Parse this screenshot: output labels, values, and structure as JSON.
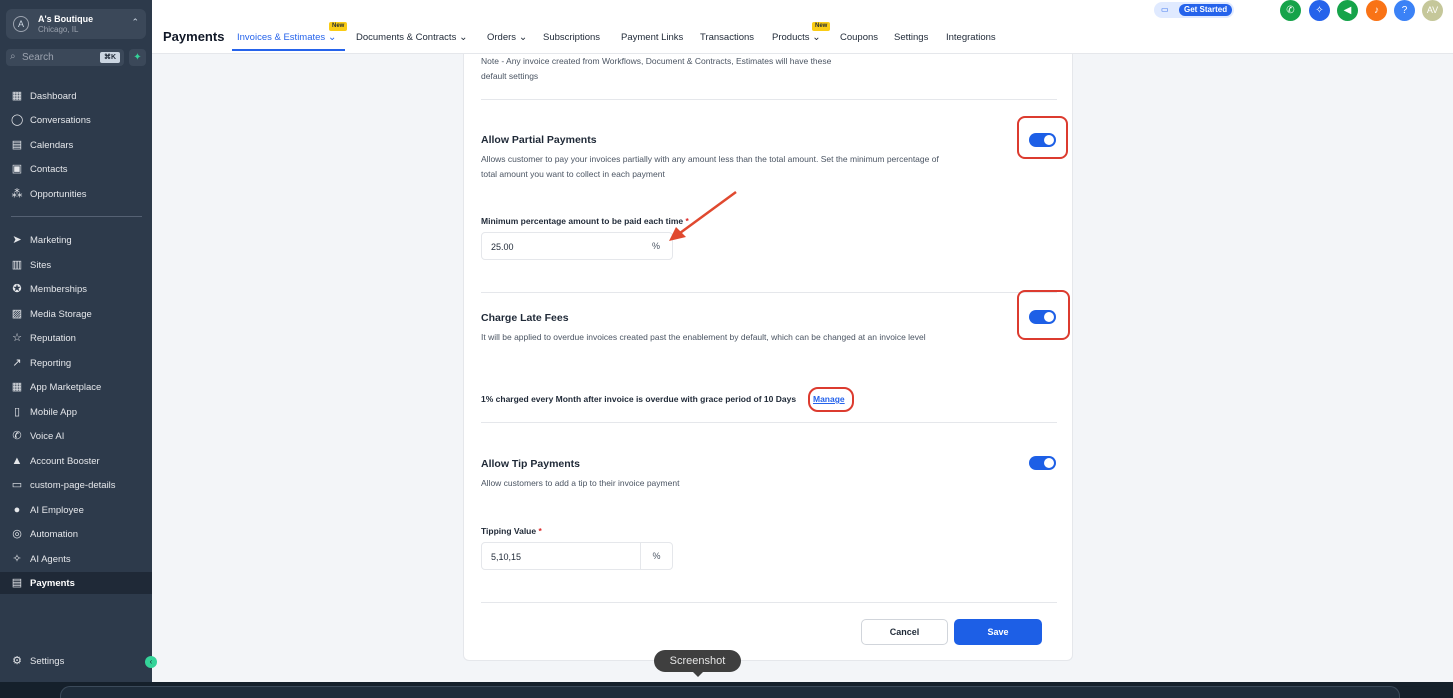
{
  "account": {
    "name": "A's Boutique",
    "location": "Chicago, IL",
    "avatar": "A"
  },
  "search": {
    "placeholder": "Search",
    "shortcut": "⌘K"
  },
  "sidebar": {
    "items": [
      {
        "label": "Dashboard",
        "icon": "grid-icon",
        "glyph": "▦"
      },
      {
        "label": "Conversations",
        "icon": "chat-icon",
        "glyph": "◯"
      },
      {
        "label": "Calendars",
        "icon": "calendar-icon",
        "glyph": "▤"
      },
      {
        "label": "Contacts",
        "icon": "contacts-icon",
        "glyph": "▣"
      },
      {
        "label": "Opportunities",
        "icon": "network-icon",
        "glyph": "⁂"
      },
      {
        "label": "Marketing",
        "icon": "send-icon",
        "glyph": "➤"
      },
      {
        "label": "Sites",
        "icon": "sites-icon",
        "glyph": "▥"
      },
      {
        "label": "Memberships",
        "icon": "award-icon",
        "glyph": "✪"
      },
      {
        "label": "Media Storage",
        "icon": "image-icon",
        "glyph": "▨"
      },
      {
        "label": "Reputation",
        "icon": "star-icon",
        "glyph": "☆"
      },
      {
        "label": "Reporting",
        "icon": "trend-icon",
        "glyph": "↗"
      },
      {
        "label": "App Marketplace",
        "icon": "apps-icon",
        "glyph": "▦"
      },
      {
        "label": "Mobile App",
        "icon": "phone-icon",
        "glyph": "▯"
      },
      {
        "label": "Voice AI",
        "icon": "voice-icon",
        "glyph": "✆"
      },
      {
        "label": "Account Booster",
        "icon": "booster-icon",
        "glyph": "▲"
      },
      {
        "label": "custom-page-details",
        "icon": "page-icon",
        "glyph": "▭"
      },
      {
        "label": "AI Employee",
        "icon": "person-icon",
        "glyph": "●"
      },
      {
        "label": "Automation",
        "icon": "automation-icon",
        "glyph": "◎"
      },
      {
        "label": "AI Agents",
        "icon": "sparkle-icon",
        "glyph": "✧"
      },
      {
        "label": "Payments",
        "icon": "receipt-icon",
        "glyph": "▤"
      }
    ],
    "settings": {
      "label": "Settings",
      "glyph": "⚙"
    }
  },
  "header": {
    "title": "Payments",
    "tabs": [
      {
        "label": "Invoices & Estimates",
        "chevron": true
      },
      {
        "label": "Documents & Contracts",
        "chevron": true
      },
      {
        "label": "Orders",
        "chevron": true
      },
      {
        "label": "Subscriptions",
        "chevron": false
      },
      {
        "label": "Payment Links",
        "chevron": false
      },
      {
        "label": "Transactions",
        "chevron": false
      },
      {
        "label": "Products",
        "chevron": true
      },
      {
        "label": "Coupons",
        "chevron": false
      },
      {
        "label": "Settings",
        "chevron": false
      },
      {
        "label": "Integrations",
        "chevron": false
      }
    ],
    "new_badge": "New",
    "get_started": "Get Started",
    "avatar": "AV",
    "help": "?"
  },
  "settings": {
    "note": "Note - Any invoice created from Workflows, Document & Contracts, Estimates will have these default settings",
    "partial": {
      "title": "Allow Partial Payments",
      "desc": "Allows customer to pay your invoices partially with any amount less than the total amount. Set the minimum percentage of total amount you want to collect in each payment",
      "enabled": true,
      "field_label": "Minimum percentage amount to be paid each time",
      "value": "25.00",
      "suffix": "%"
    },
    "late": {
      "title": "Charge Late Fees",
      "desc": "It will be applied to overdue invoices created past the enablement by default, which can be changed at an invoice level",
      "enabled": true,
      "summary": "1% charged every Month after invoice is overdue with grace period of 10 Days",
      "manage": "Manage"
    },
    "tip": {
      "title": "Allow Tip Payments",
      "desc": "Allow customers to add a tip to their invoice payment",
      "enabled": true,
      "field_label": "Tipping Value",
      "value": "5,10,15",
      "suffix": "%"
    },
    "required_mark": "*",
    "cancel": "Cancel",
    "save": "Save"
  },
  "tooltip": "Screenshot",
  "colors": {
    "primary": "#1d5fe6",
    "sidebar": "#2d3a4b",
    "highlight": "#dc3b2f"
  }
}
